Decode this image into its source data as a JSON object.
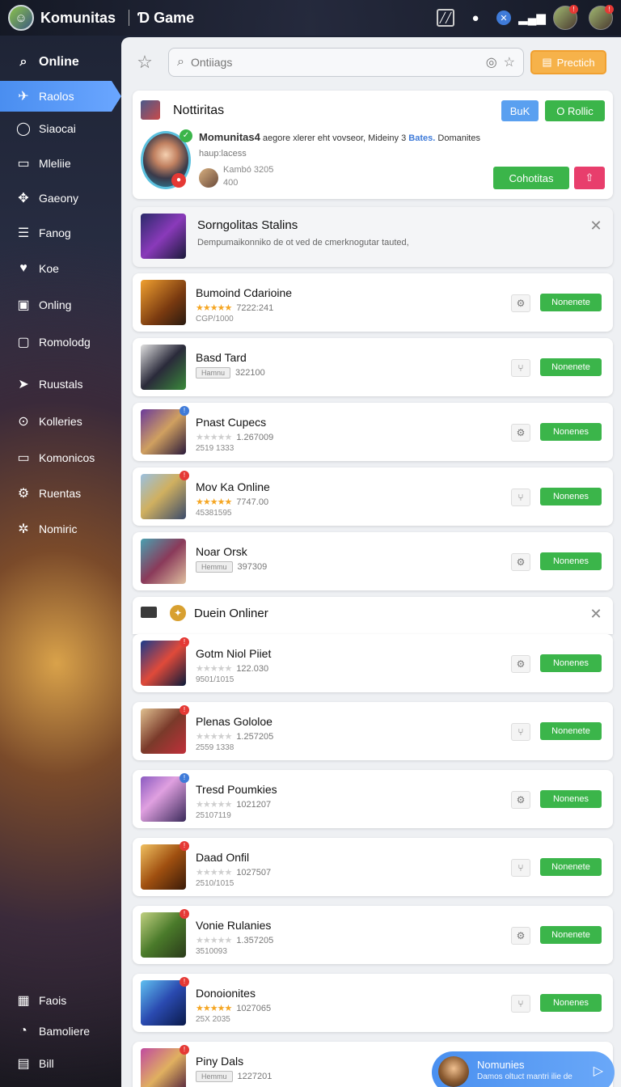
{
  "topbar": {
    "brand": "Komunitas",
    "brand2": "Ɗ Game",
    "icons": [
      "chart-icon",
      "chat-icon",
      "discord-icon",
      "signal-icon"
    ]
  },
  "sidebar": {
    "items": [
      {
        "label": "Online",
        "icon": "search-icon"
      },
      {
        "label": "Raolos",
        "icon": "megaphone-icon"
      },
      {
        "label": "Siaocai",
        "icon": "ring-icon"
      },
      {
        "label": "Mleliie",
        "icon": "note-icon"
      },
      {
        "label": "Gaeony",
        "icon": "puzzle-icon"
      },
      {
        "label": "Fanog",
        "icon": "list-icon"
      },
      {
        "label": "Koe",
        "icon": "heart-icon"
      },
      {
        "label": "Onling",
        "icon": "frame-icon"
      },
      {
        "label": "Romolodg",
        "icon": "file-icon"
      },
      {
        "label": "Ruustals",
        "icon": "send-icon"
      },
      {
        "label": "Kolleries",
        "icon": "search-circle-icon"
      },
      {
        "label": "Komonicos",
        "icon": "chat-box-icon"
      },
      {
        "label": "Ruentas",
        "icon": "gear-icon"
      },
      {
        "label": "Nomiric",
        "icon": "settings-icon"
      }
    ],
    "bottom": [
      {
        "label": "Faois",
        "icon": "calendar-icon"
      },
      {
        "label": "Bamoliere",
        "icon": "user-icon"
      },
      {
        "label": "Bill",
        "icon": "table-icon"
      }
    ]
  },
  "search": {
    "placeholder": "Ontiiags"
  },
  "action_button": "Prectich",
  "profile": {
    "title": "Nottiritas",
    "buk": "BuK",
    "rollic": "O Rollic",
    "name": "Momunitas4",
    "desc": "aegore xlerer eht vovseor, Mideiny 3",
    "bates": "Bates.",
    "domanites": "Domanites",
    "sub": "haup:lacess",
    "stat1": "Kambó 3205",
    "stat2": "400",
    "cohotitas": "Cohotitas"
  },
  "banner": {
    "title": "Sorngolitas Stalins",
    "subtitle": "Dempumaikonniko de ot ved de cmerknogutar tauted,"
  },
  "games1": [
    {
      "title": "Bumoind Cdarioine",
      "rating": "stars",
      "num": "7222:241",
      "sub": "CGP/1000",
      "btn": "Nonenete"
    },
    {
      "title": "Basd Tard",
      "rating": "tag",
      "tag": "Hamnu",
      "num": "322100",
      "sub": "",
      "btn": "Nonenete"
    },
    {
      "title": "Pnast Cupecs",
      "rating": "gray",
      "num": "1.267009",
      "sub": "2519 1333",
      "btn": "Nonenes"
    },
    {
      "title": "Mov Ka Online",
      "rating": "stars",
      "num": "7747.00",
      "sub": "45381595",
      "btn": "Nonenes"
    },
    {
      "title": "Noar Orsk",
      "rating": "tag",
      "tag": "Hemmu",
      "num": "397309",
      "sub": "",
      "btn": "Nonenes"
    }
  ],
  "section2": {
    "title": "Duein Onliner"
  },
  "games2": [
    {
      "title": "Gotm Niol Piiet",
      "rating": "gray",
      "num": "122.030",
      "sub": "9501/1015",
      "btn": "Nonenes"
    },
    {
      "title": "Plenas Gololoe",
      "rating": "gray",
      "num": "1.257205",
      "sub": "2559 1338",
      "btn": "Nonenete"
    },
    {
      "title": "Tresd Poumkies",
      "rating": "gray",
      "num": "1021207",
      "sub": "25107119",
      "btn": "Nonenes"
    },
    {
      "title": "Daad Onfil",
      "rating": "gray",
      "num": "1027507",
      "sub": "2510/1015",
      "btn": "Nonenete"
    },
    {
      "title": "Vonie Rulanies",
      "rating": "gray",
      "num": "1.357205",
      "sub": "3510093",
      "btn": "Nonenete"
    },
    {
      "title": "Donoionites",
      "rating": "stars",
      "num": "1027065",
      "sub": "25X 2035",
      "btn": "Nonenes"
    },
    {
      "title": "Piny Dals",
      "rating": "tag",
      "tag": "Hemmu",
      "num": "1227201",
      "sub": "",
      "btn": ""
    }
  ],
  "floating": {
    "title": "Nomunies",
    "subtitle": "Damos oltuct mantri ilie de"
  },
  "colors": {
    "green": "#3bb54a",
    "blue": "#4a8ef0",
    "orange": "#f6b24a",
    "pink": "#e83e6c"
  }
}
